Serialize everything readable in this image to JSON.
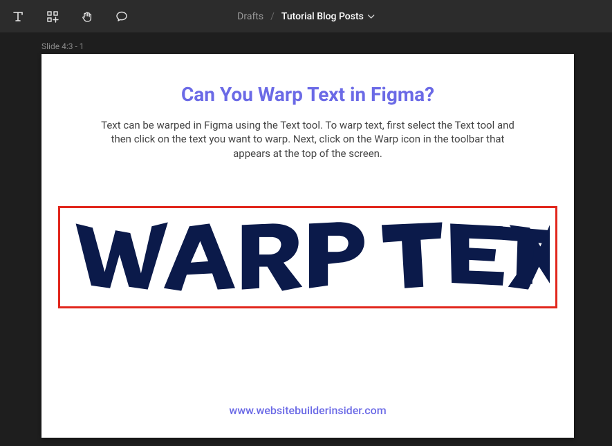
{
  "breadcrumb": {
    "drafts": "Drafts",
    "separator": "/",
    "file": "Tutorial Blog Posts"
  },
  "tools": {
    "text": "T",
    "plus": "components-icon",
    "hand": "hand-icon",
    "comment": "comment-icon"
  },
  "frame_label": "Slide 4:3 - 1",
  "slide": {
    "title": "Can You Warp Text in Figma?",
    "body": "Text can be warped in Figma using the Text tool. To warp text, first select the Text tool and then click on the text you want to warp. Next, click on the Warp icon in the toolbar that appears at the top of the screen.",
    "warp_text": "WARP TEXT",
    "footer": "www.websitebuilderinsider.com"
  },
  "colors": {
    "accent": "#6b6ae6",
    "highlight_border": "#e1261c",
    "warp_fill": "#0b1a4a"
  }
}
